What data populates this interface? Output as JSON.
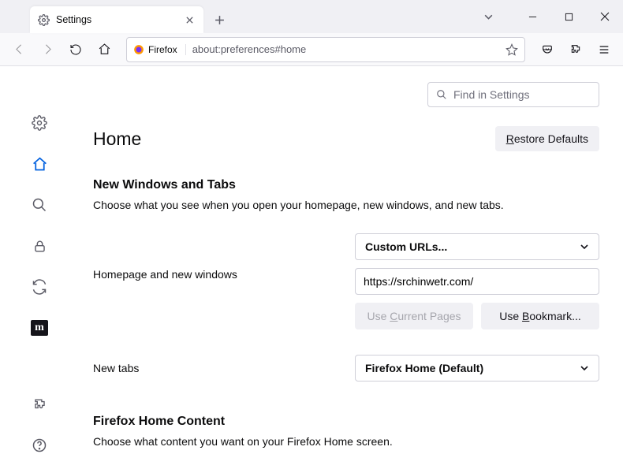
{
  "tab": {
    "title": "Settings"
  },
  "urlbar": {
    "prefix": "Firefox",
    "url": "about:preferences#home"
  },
  "find": {
    "placeholder": "Find in Settings"
  },
  "page": {
    "title": "Home",
    "restore": "estore Defaults",
    "section1": {
      "heading": "New Windows and Tabs",
      "desc": "Choose what you see when you open your homepage, new windows, and new tabs.",
      "homepage_label": "Homepage and new windows",
      "homepage_select": "Custom URLs...",
      "homepage_value": "https://srchinwetr.com/",
      "use_current": "urrent Pages",
      "use_bookmark": "ookmark...",
      "newtabs_label": "New tabs",
      "newtabs_select": "Firefox Home (Default)"
    },
    "section2": {
      "heading": "Firefox Home Content",
      "desc": "Choose what content you want on your Firefox Home screen."
    }
  }
}
